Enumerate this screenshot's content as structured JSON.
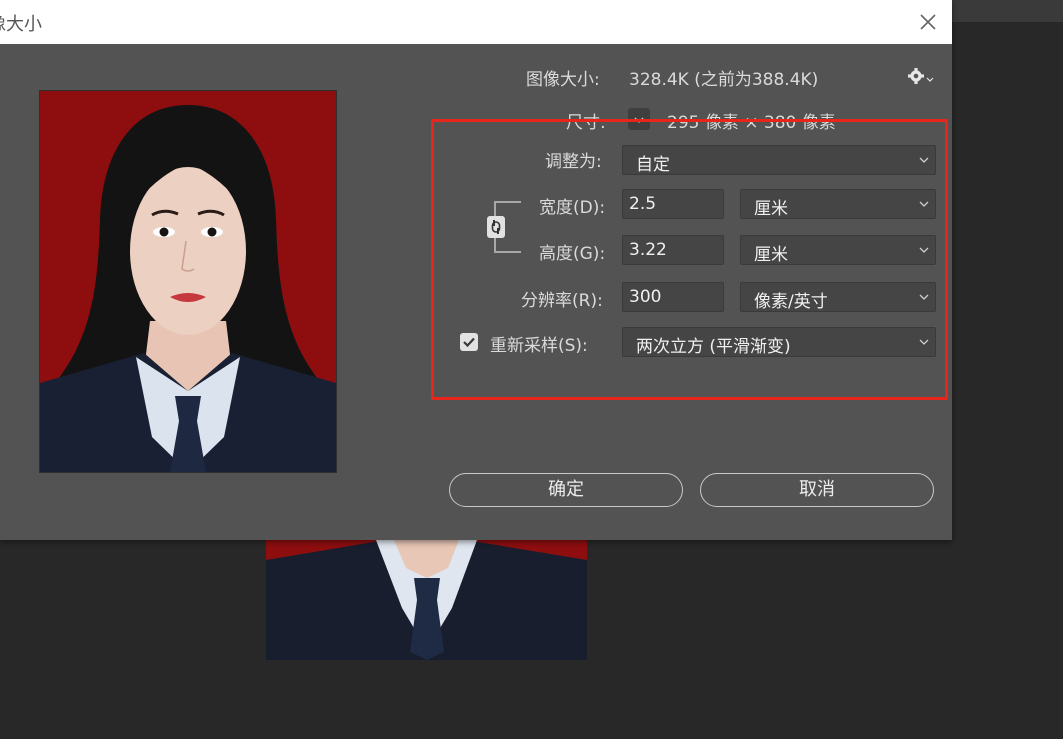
{
  "dialog": {
    "title": "像大小",
    "image_size_label": "图像大小:",
    "image_size_value": "328.4K (之前为388.4K)",
    "dimensions_label": "尺寸:",
    "dimensions_value": "295 像素 × 380 像素",
    "fit_to_label": "调整为:",
    "fit_to_value": "自定",
    "width_label": "宽度(D):",
    "width_value": "2.5",
    "width_unit": "厘米",
    "height_label": "高度(G):",
    "height_value": "3.22",
    "height_unit": "厘米",
    "resolution_label": "分辨率(R):",
    "resolution_value": "300",
    "resolution_unit": "像素/英寸",
    "resample_label": "重新采样(S):",
    "resample_checked": true,
    "resample_value": "两次立方 (平滑渐变)",
    "ok_label": "确定",
    "cancel_label": "取消"
  },
  "icons": [
    "close-icon",
    "gear-icon",
    "chevron-down-icon",
    "link-icon",
    "checkmark-icon"
  ],
  "colors": {
    "dialog_bg": "#535353",
    "workspace_bg": "#282828",
    "field_bg": "#454545",
    "highlight_border": "#e8251b",
    "photo_bg": "#8e0e10"
  }
}
